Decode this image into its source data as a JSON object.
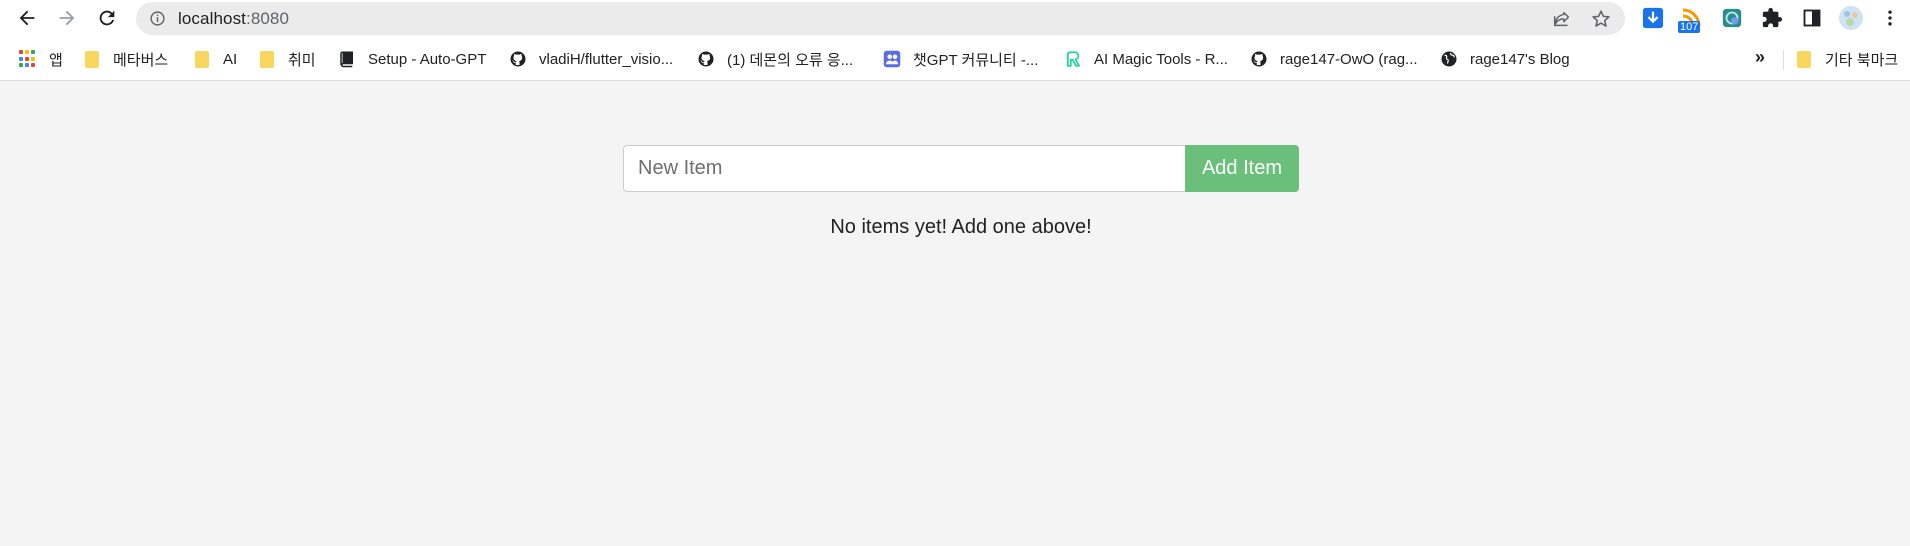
{
  "browser": {
    "url_host": "localhost",
    "url_port": ":8080",
    "nav": {
      "back": "back-arrow-icon",
      "forward": "forward-arrow-icon",
      "reload": "reload-icon"
    },
    "extensions": [
      {
        "name": "download-icon",
        "color": "#1a73e8"
      },
      {
        "name": "rss-feed-icon",
        "badge": "107",
        "color": "#f29900"
      },
      {
        "name": "extension-app-icon",
        "color": "#2a8c8c"
      },
      {
        "name": "puzzle-icon"
      },
      {
        "name": "side-panel-icon"
      },
      {
        "name": "profile-avatar-icon"
      },
      {
        "name": "kebab-menu-icon"
      }
    ]
  },
  "bookmarks": [
    {
      "label": "앱",
      "icon": "apps-grid-icon"
    },
    {
      "label": "메타버스",
      "icon": "folder-icon"
    },
    {
      "label": "AI",
      "icon": "folder-icon"
    },
    {
      "label": "취미",
      "icon": "folder-icon"
    },
    {
      "label": "Setup - Auto-GPT",
      "icon": "book-icon"
    },
    {
      "label": "vladiH/flutter_visio...",
      "icon": "github-icon"
    },
    {
      "label": "(1) 데몬의 오류 응...",
      "icon": "github-icon"
    },
    {
      "label": "챗GPT 커뮤니티 -...",
      "icon": "community-icon"
    },
    {
      "label": "AI Magic Tools - R...",
      "icon": "runway-icon"
    },
    {
      "label": "rage147-OwO (rag...",
      "icon": "github-icon"
    },
    {
      "label": "rage147's Blog",
      "icon": "globe-icon"
    }
  ],
  "bookmarks_overflow": "»",
  "other_bookmarks": {
    "label": "기타 북마크",
    "icon": "folder-icon"
  },
  "app": {
    "input_placeholder": "New Item",
    "input_value": "",
    "add_button_label": "Add Item",
    "empty_message": "No items yet! Add one above!",
    "accent_color": "#6abf7a"
  }
}
